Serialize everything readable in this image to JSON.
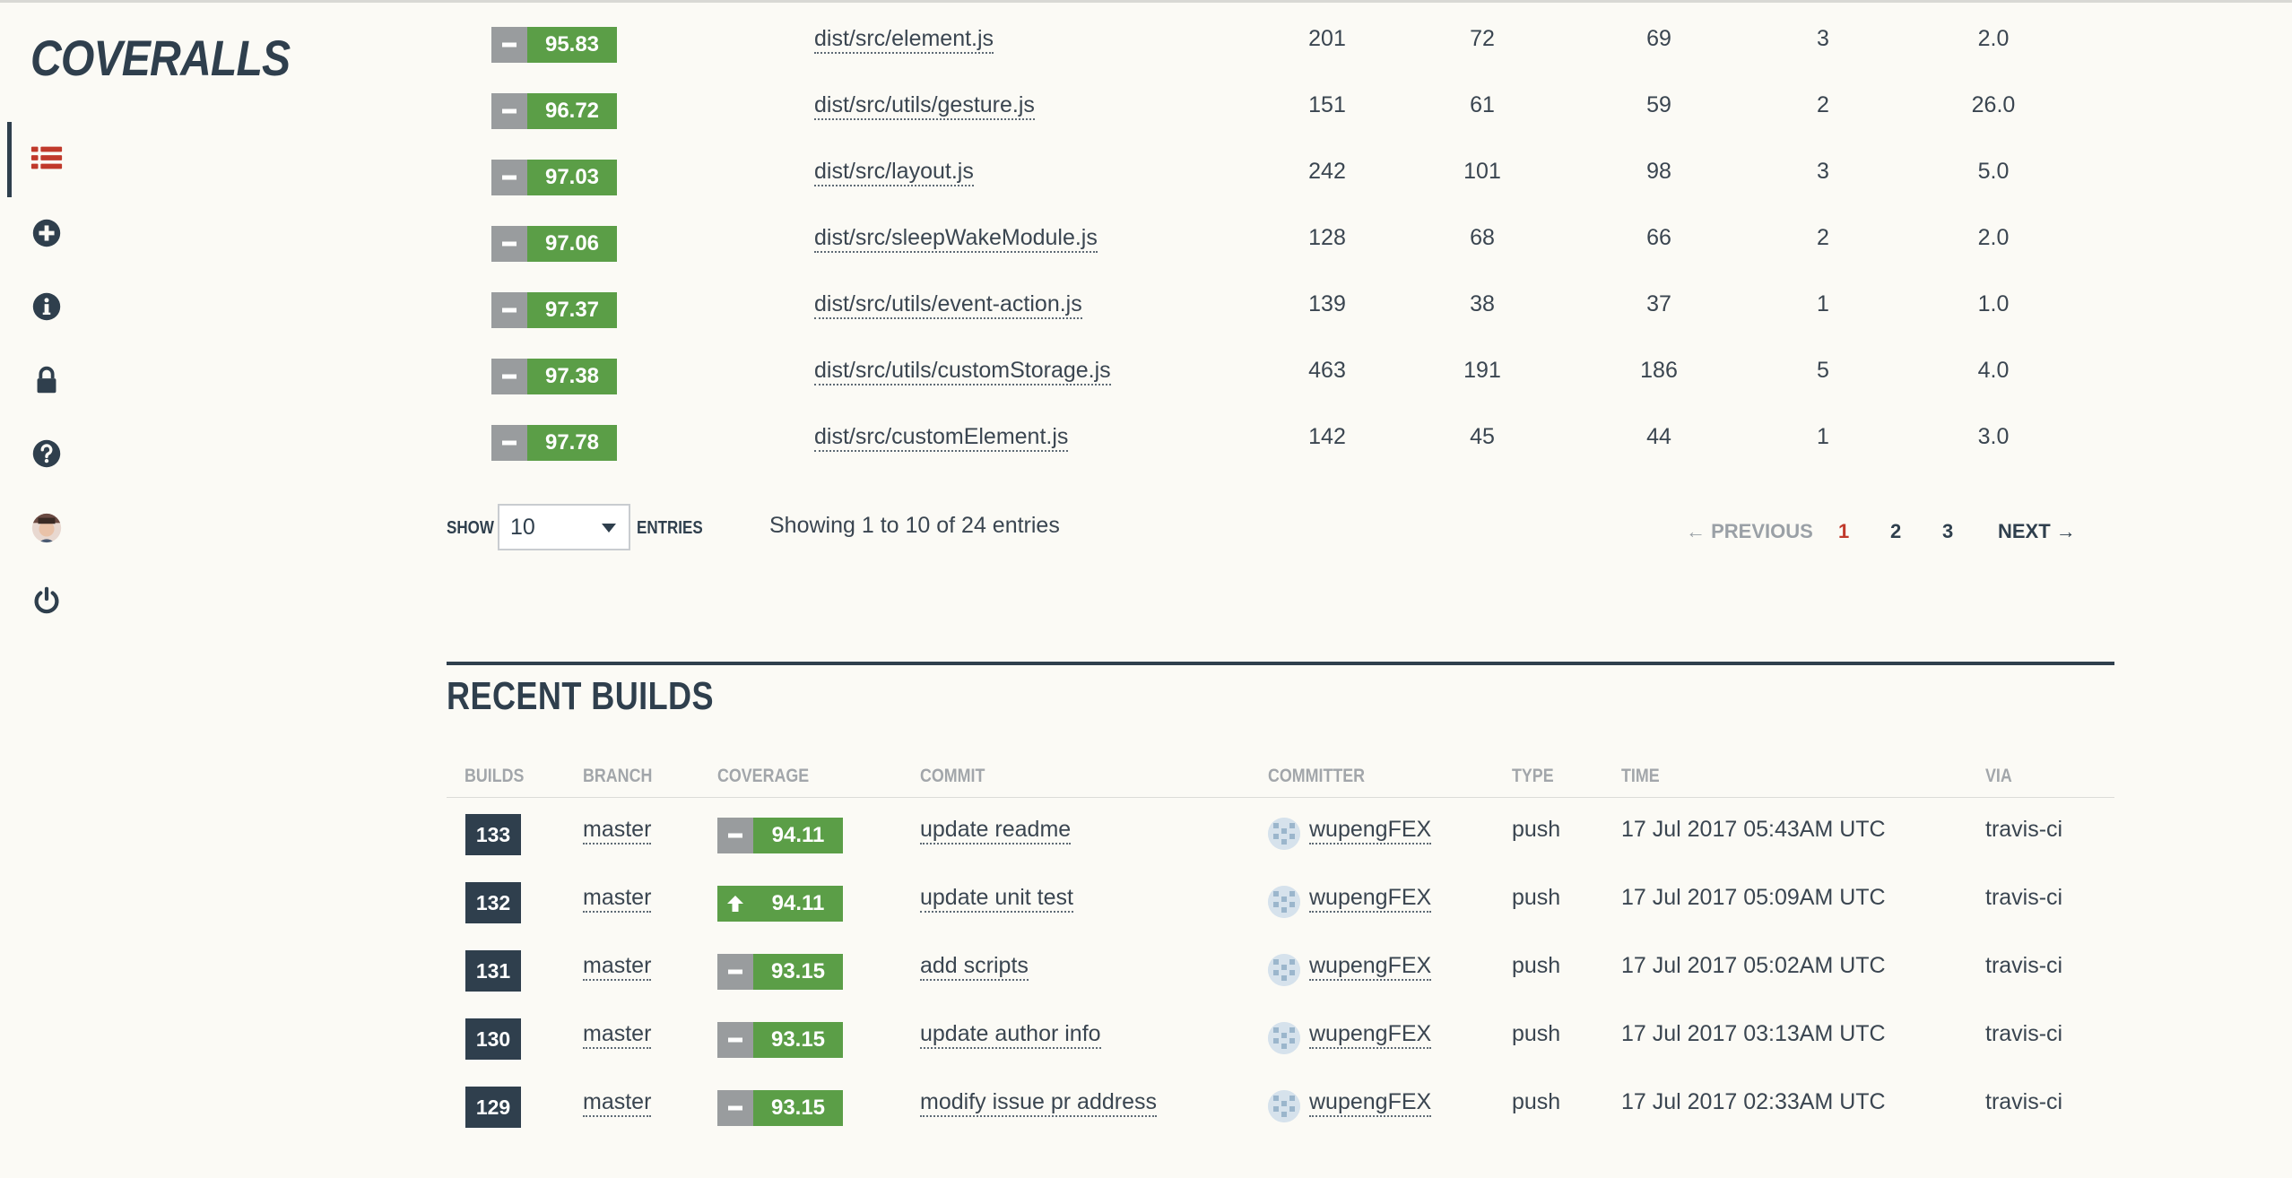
{
  "app": {
    "logo_text": "COVERALLS"
  },
  "sidebar": {
    "items": [
      {
        "name": "builds-list-icon",
        "active": true
      },
      {
        "name": "add-repo-icon"
      },
      {
        "name": "info-icon"
      },
      {
        "name": "lock-icon"
      },
      {
        "name": "help-icon"
      },
      {
        "name": "user-avatar"
      },
      {
        "name": "power-icon"
      }
    ]
  },
  "files": {
    "rows": [
      {
        "coverage": "95.83",
        "trend": "none",
        "path": "dist/src/element.js",
        "lines": "201",
        "relevant": "72",
        "covered": "69",
        "missed": "3",
        "hits": "2.0"
      },
      {
        "coverage": "96.72",
        "trend": "none",
        "path": "dist/src/utils/gesture.js",
        "lines": "151",
        "relevant": "61",
        "covered": "59",
        "missed": "2",
        "hits": "26.0"
      },
      {
        "coverage": "97.03",
        "trend": "none",
        "path": "dist/src/layout.js",
        "lines": "242",
        "relevant": "101",
        "covered": "98",
        "missed": "3",
        "hits": "5.0"
      },
      {
        "coverage": "97.06",
        "trend": "none",
        "path": "dist/src/sleepWakeModule.js",
        "lines": "128",
        "relevant": "68",
        "covered": "66",
        "missed": "2",
        "hits": "2.0"
      },
      {
        "coverage": "97.37",
        "trend": "none",
        "path": "dist/src/utils/event-action.js",
        "lines": "139",
        "relevant": "38",
        "covered": "37",
        "missed": "1",
        "hits": "1.0"
      },
      {
        "coverage": "97.38",
        "trend": "none",
        "path": "dist/src/utils/customStorage.js",
        "lines": "463",
        "relevant": "191",
        "covered": "186",
        "missed": "5",
        "hits": "4.0"
      },
      {
        "coverage": "97.78",
        "trend": "none",
        "path": "dist/src/customElement.js",
        "lines": "142",
        "relevant": "45",
        "covered": "44",
        "missed": "1",
        "hits": "3.0"
      }
    ],
    "footer": {
      "show_label": "SHOW",
      "page_size": "10",
      "entries_label": "ENTRIES",
      "info": "Showing 1 to 10 of 24 entries",
      "previous_label": "← PREVIOUS",
      "pages": [
        "1",
        "2",
        "3"
      ],
      "current_page": "1",
      "next_label": "NEXT →"
    }
  },
  "recent_builds": {
    "title": "RECENT BUILDS",
    "columns": {
      "builds": "BUILDS",
      "branch": "BRANCH",
      "coverage": "COVERAGE",
      "commit": "COMMIT",
      "committer": "COMMITTER",
      "type": "TYPE",
      "time": "TIME",
      "via": "VIA"
    },
    "rows": [
      {
        "build": "133",
        "branch": "master",
        "coverage": "94.11",
        "trend": "none",
        "commit": "update readme",
        "committer": "wupengFEX",
        "type": "push",
        "time": "17 Jul 2017 05:43AM UTC",
        "via": "travis-ci"
      },
      {
        "build": "132",
        "branch": "master",
        "coverage": "94.11",
        "trend": "up",
        "commit": "update unit test",
        "committer": "wupengFEX",
        "type": "push",
        "time": "17 Jul 2017 05:09AM UTC",
        "via": "travis-ci"
      },
      {
        "build": "131",
        "branch": "master",
        "coverage": "93.15",
        "trend": "none",
        "commit": "add scripts",
        "committer": "wupengFEX",
        "type": "push",
        "time": "17 Jul 2017 05:02AM UTC",
        "via": "travis-ci"
      },
      {
        "build": "130",
        "branch": "master",
        "coverage": "93.15",
        "trend": "none",
        "commit": "update author info",
        "committer": "wupengFEX",
        "type": "push",
        "time": "17 Jul 2017 03:13AM UTC",
        "via": "travis-ci"
      },
      {
        "build": "129",
        "branch": "master",
        "coverage": "93.15",
        "trend": "none",
        "commit": "modify issue pr address",
        "committer": "wupengFEX",
        "type": "push",
        "time": "17 Jul 2017 02:33AM UTC",
        "via": "travis-ci"
      }
    ]
  },
  "colors": {
    "primary": "#2f3f4d",
    "coverage_green": "#5b9e47",
    "neutral_gray": "#999c9e",
    "active_page": "#c0392b",
    "nav_accent": "#c0392b"
  }
}
